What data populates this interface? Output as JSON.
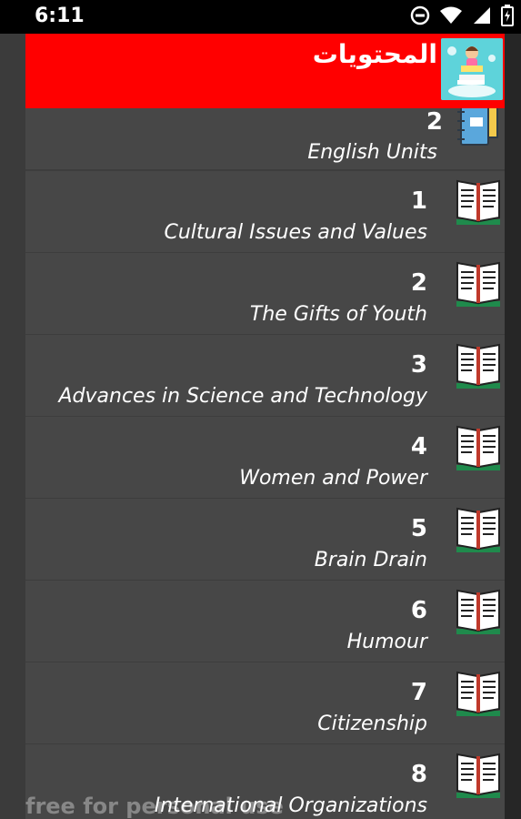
{
  "status_bar": {
    "time": "6:11"
  },
  "header": {
    "title": "المحتويات"
  },
  "sub_header": {
    "number": "2",
    "label": "English Units"
  },
  "units": [
    {
      "number": "1",
      "title": "Cultural Issues and Values"
    },
    {
      "number": "2",
      "title": "The Gifts of Youth"
    },
    {
      "number": "3",
      "title": "Advances in Science and Technology"
    },
    {
      "number": "4",
      "title": "Women and Power"
    },
    {
      "number": "5",
      "title": "Brain Drain"
    },
    {
      "number": "6",
      "title": "Humour"
    },
    {
      "number": "7",
      "title": "Citizenship"
    },
    {
      "number": "8",
      "title": "International Organizations"
    }
  ],
  "watermark": "free for personal use",
  "icons": {
    "status": [
      "do-not-disturb-icon",
      "wifi-icon",
      "signal-icon",
      "battery-charging-icon"
    ],
    "header_logo": "reading-child-logo",
    "sub_header": "notebook-icon",
    "unit": "open-book-icon"
  },
  "colors": {
    "header_bg": "#ff0000",
    "list_bg": "#474747",
    "status_bg": "#000000"
  }
}
